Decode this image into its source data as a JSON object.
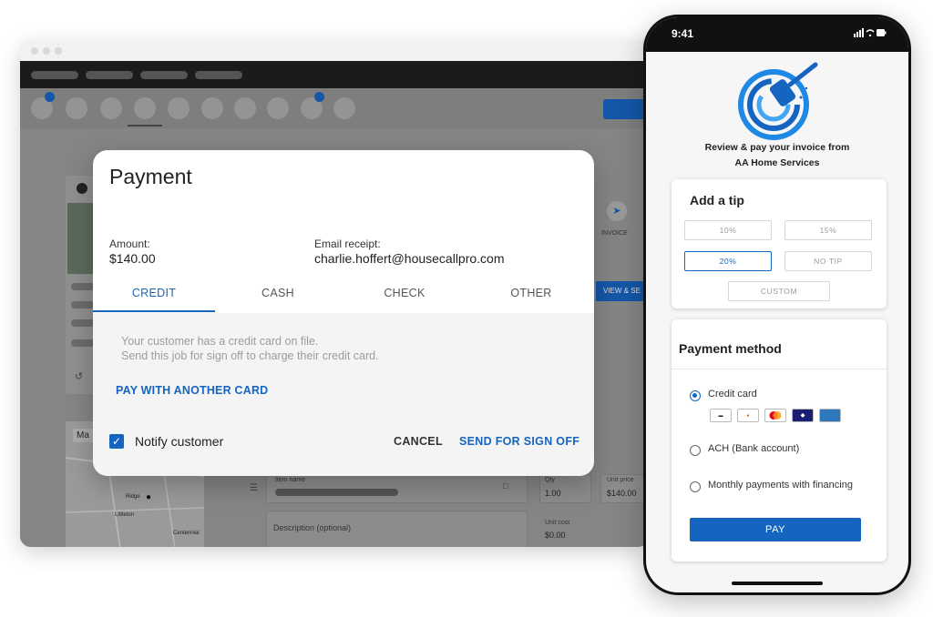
{
  "modal": {
    "title": "Payment",
    "amount_label": "Amount:",
    "amount_value": "$140.00",
    "email_label": "Email receipt:",
    "email_value": "charlie.hoffert@housecallpro.com",
    "tabs": [
      {
        "label": "CREDIT",
        "active": true
      },
      {
        "label": "CASH",
        "active": false
      },
      {
        "label": "CHECK",
        "active": false
      },
      {
        "label": "OTHER",
        "active": false
      }
    ],
    "hint_line1": "Your customer has a credit card on file.",
    "hint_line2": "Send this job for sign off to charge their credit card.",
    "pay_another_card": "PAY WITH ANOTHER CARD",
    "notify_customer": "Notify customer",
    "notify_checked": true,
    "cancel_label": "CANCEL",
    "send_label": "SEND FOR SIGN OFF"
  },
  "background": {
    "invoice_label": "INVOICE",
    "view_button": "VIEW & SE",
    "map_label": "Ma",
    "item_name_label": "Item name",
    "qty_label": "Qty",
    "qty_value": "1.00",
    "unit_price_label": "Unit price",
    "unit_price_value": "$140.00",
    "unit_cost_label": "Unit cost",
    "unit_cost_value": "$0.00",
    "description_placeholder": "Description (optional)",
    "map_places": [
      "Ridge",
      "Littleton",
      "Centennial"
    ]
  },
  "phone": {
    "time": "9:41",
    "review_line1": "Review & pay your invoice from",
    "review_line2": "AA Home Services",
    "tip_title": "Add a tip",
    "tip_options": [
      "10%",
      "15%",
      "20%",
      "NO TIP"
    ],
    "tip_selected": "20%",
    "custom_label": "CUSTOM",
    "payment_title": "Payment method",
    "methods": [
      {
        "label": "Credit card",
        "selected": true
      },
      {
        "label": "ACH (Bank account)",
        "selected": false
      },
      {
        "label": "Monthly payments with financing",
        "selected": false
      }
    ],
    "card_brands": [
      "CARD",
      "DISCOVER",
      "MC",
      "VISA",
      "AMEX"
    ],
    "pay_label": "PAY"
  },
  "colors": {
    "accent": "#1565c0",
    "overlay": "#858585",
    "nav_dark": "#1b1b1b"
  }
}
